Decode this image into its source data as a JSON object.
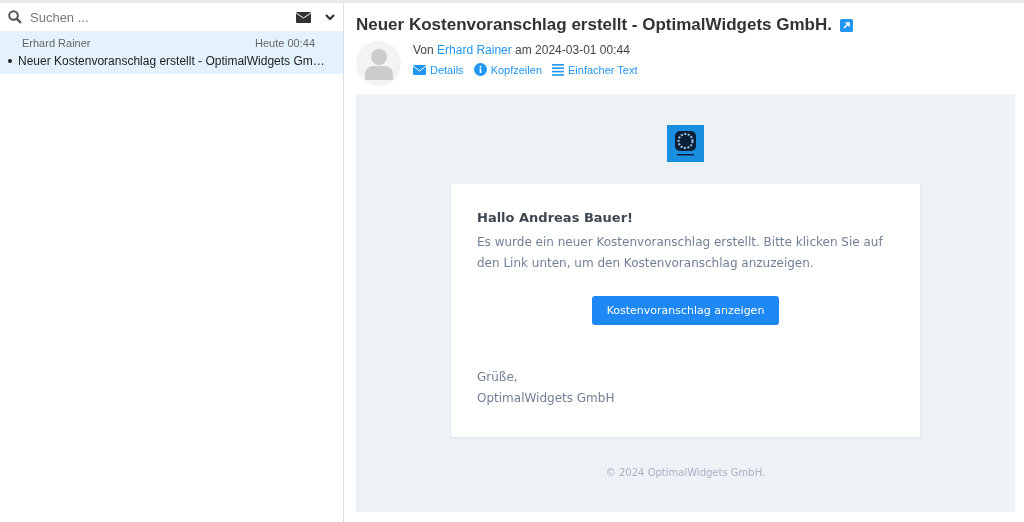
{
  "search": {
    "placeholder": "Suchen ..."
  },
  "messages": [
    {
      "sender": "Erhard Rainer",
      "time": "Heute 00:44",
      "subject": "Neuer Kostenvoranschlag erstellt - OptimalWidgets Gm…",
      "unread": true,
      "selected": true
    }
  ],
  "message": {
    "title": "Neuer Kostenvoranschlag erstellt - OptimalWidgets GmbH.",
    "from_label": "Von",
    "sender": "Erhard Rainer",
    "date_label": "am 2024-03-01 00:44",
    "actions": [
      {
        "kind": "details",
        "label": "Details"
      },
      {
        "kind": "headers",
        "label": "Kopfzeilen"
      },
      {
        "kind": "plain",
        "label": "Einfacher Text"
      }
    ],
    "body": {
      "greeting": "Hallo Andreas Bauer!",
      "text": "Es wurde ein neuer Kostenvoranschlag erstellt. Bitte klicken Sie auf den Link unten, um den Kostenvoranschlag anzuzeigen.",
      "button": "Kostenvoranschlag anzeigen",
      "closing": "Grüße,",
      "signature": "OptimalWidgets GmbH",
      "footer": "© 2024 OptimalWidgets GmbH."
    }
  }
}
